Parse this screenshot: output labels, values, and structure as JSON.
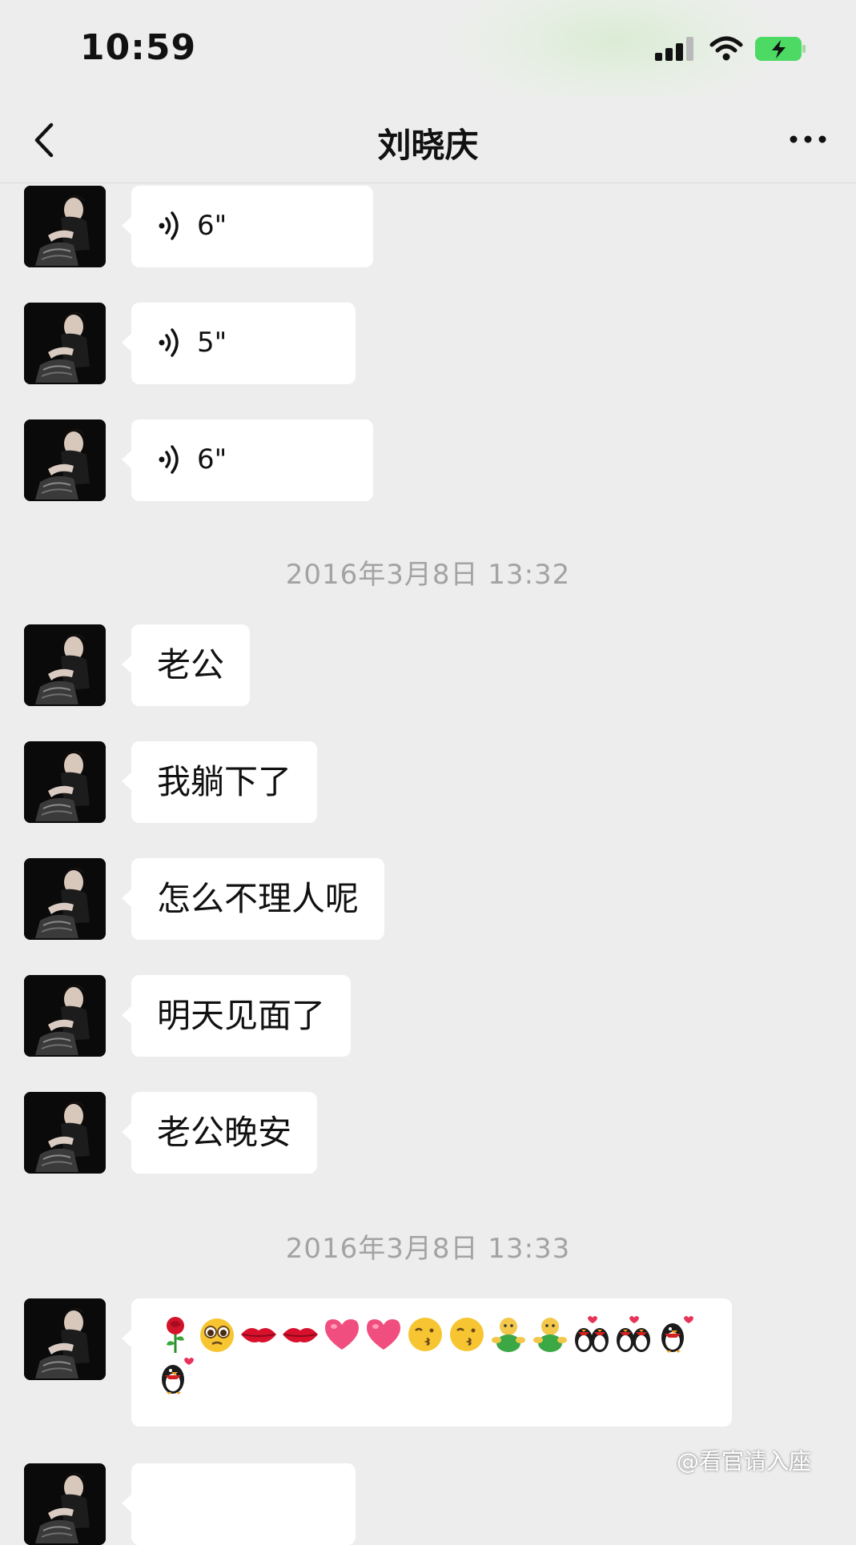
{
  "status_bar": {
    "time": "10:59"
  },
  "nav": {
    "title": "刘晓庆",
    "back_icon": "chevron-left-icon",
    "more_icon": "ellipsis-icon"
  },
  "voice_messages": [
    {
      "duration": "6\""
    },
    {
      "duration": "5\""
    },
    {
      "duration": "6\""
    }
  ],
  "timestamps": [
    "2016年3月8日 13:32",
    "2016年3月8日 13:33"
  ],
  "text_messages": [
    {
      "text": "老公"
    },
    {
      "text": "我躺下了"
    },
    {
      "text": "怎么不理人呢"
    },
    {
      "text": "明天见面了"
    },
    {
      "text": "老公晚安"
    }
  ],
  "emoji_message": {
    "emojis": [
      "rose",
      "pleading-face",
      "lips",
      "lips",
      "heart",
      "heart",
      "kissing-face",
      "kissing-face",
      "hug-figure",
      "hug-figure",
      "penguin-couple",
      "penguin-couple",
      "penguin-love",
      "penguin-love"
    ]
  },
  "watermark": "@看官请入座",
  "colors": {
    "background": "#ededed",
    "bubble": "#ffffff",
    "timestamp": "#a3a3a3",
    "battery_green": "#4cd964"
  }
}
